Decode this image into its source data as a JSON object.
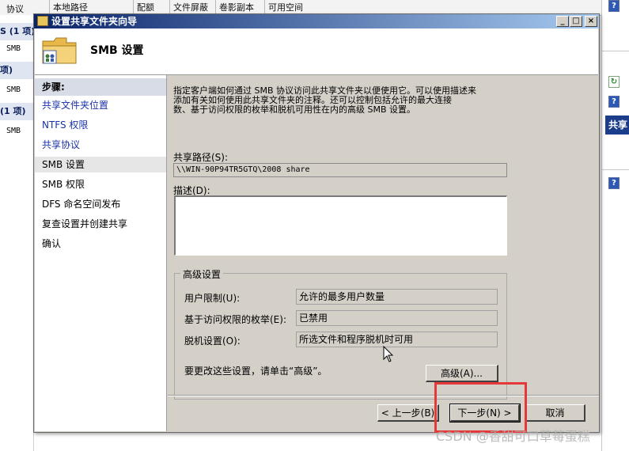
{
  "background": {
    "columns": [
      "协议",
      "本地路径",
      "配额",
      "文件屏蔽",
      "卷影副本",
      "可用空间"
    ],
    "left_groups": [
      {
        "label": "S (1 项)"
      },
      {
        "label": "项)"
      },
      {
        "label": "(1 项)"
      }
    ],
    "left_items": [
      "SMB",
      "SMB",
      "SMB"
    ],
    "right_panel_label": "共享"
  },
  "dialog": {
    "title": "设置共享文件夹向导",
    "header_title": "SMB 设置",
    "window_buttons": {
      "minimize": "_",
      "maximize": "□",
      "close": "×"
    }
  },
  "sidebar": {
    "title": "步骤:",
    "steps": [
      {
        "label": "共享文件夹位置",
        "state": "link"
      },
      {
        "label": "NTFS 权限",
        "state": "link"
      },
      {
        "label": "共享协议",
        "state": "link"
      },
      {
        "label": "SMB 设置",
        "state": "current"
      },
      {
        "label": "SMB 权限",
        "state": "plain"
      },
      {
        "label": "DFS 命名空间发布",
        "state": "plain"
      },
      {
        "label": "复查设置并创建共享",
        "state": "plain"
      },
      {
        "label": "确认",
        "state": "plain"
      }
    ]
  },
  "main": {
    "description_lines": [
      "指定客户端如何通过 SMB 协议访问此共享文件夹以便使用它。可以使用描述来",
      "添加有关如何使用此共享文件夹的注释。还可以控制包括允许的最大连接",
      "数、基于访问权限的枚举和脱机可用性在内的高级 SMB 设置。"
    ],
    "share_path_label": "共享路径(S):",
    "share_path_value": "\\\\WIN-90P94TR5GTQ\\2008 share",
    "description_label": "描述(D):",
    "description_value": "",
    "advanced": {
      "title": "高级设置",
      "user_limit_label": "用户限制(U):",
      "user_limit_value": "允许的最多用户数量",
      "abe_label": "基于访问权限的枚举(E):",
      "abe_value": "已禁用",
      "offline_label": "脱机设置(O):",
      "offline_value": "所选文件和程序脱机时可用",
      "hint": "要更改这些设置，请单击“高级”。",
      "advanced_button": "高级(A)..."
    }
  },
  "footer": {
    "back_button": "< 上一步(B)",
    "next_button": "下一步(N) >",
    "cancel_button": "取消"
  },
  "watermark": "CSDN @香甜可口草莓蛋糕",
  "colors": {
    "title_start": "#0a246a",
    "title_end": "#a6caf0",
    "link": "#1a32a8",
    "highlight": "#e53838"
  }
}
